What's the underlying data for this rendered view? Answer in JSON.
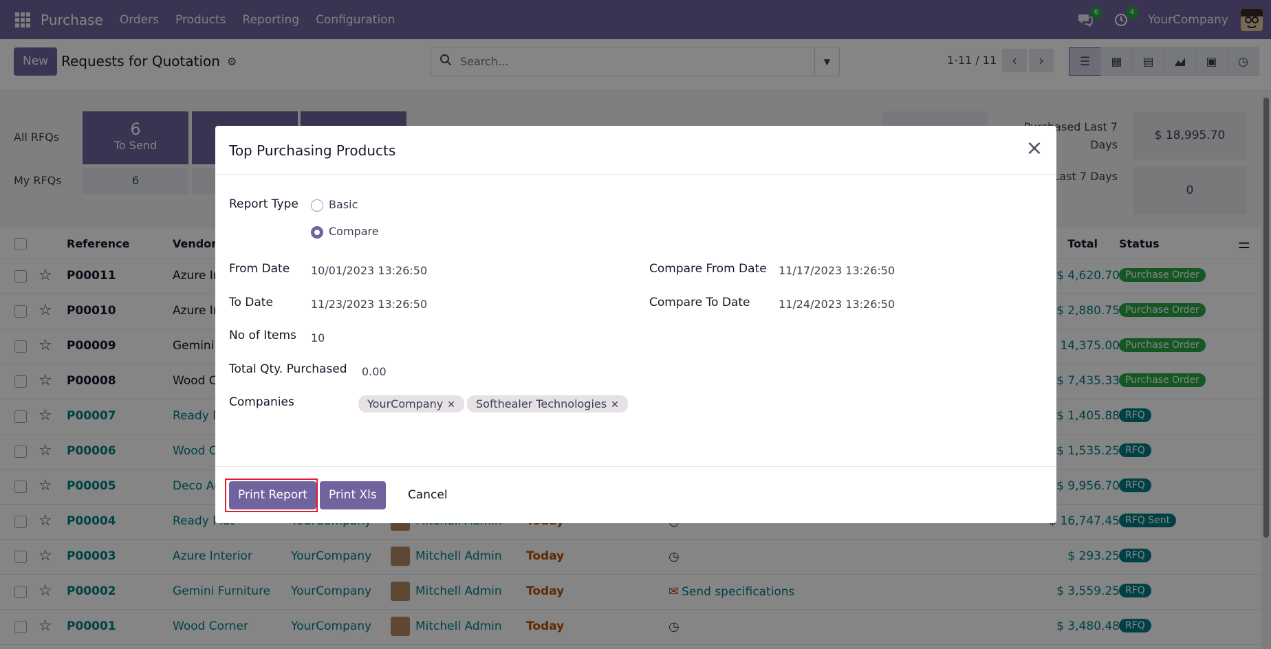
{
  "navbar": {
    "app_name": "Purchase",
    "menu": [
      "Orders",
      "Products",
      "Reporting",
      "Configuration"
    ],
    "messages_count": "6",
    "activities_count": "4",
    "company": "YourCompany"
  },
  "control": {
    "new_label": "New",
    "title": "Requests for Quotation",
    "search_placeholder": "Search...",
    "pager": "1-11 / 11"
  },
  "dashboard": {
    "all_rfqs_label": "All RFQs",
    "my_rfqs_label": "My RFQs",
    "to_send_count": "6",
    "to_send_label": "To Send",
    "my_to_send": "6",
    "purchased_last_7_label": "Purchased Last 7 Days",
    "purchased_last_7_value": "$ 18,995.70",
    "sent_last_7_label": "Sent Last 7 Days",
    "sent_last_7_value": "0"
  },
  "list": {
    "headers": {
      "reference": "Reference",
      "vendor": "Vendor",
      "total": "Total",
      "status": "Status"
    },
    "rows": [
      {
        "ref": "P00011",
        "vendor": "Azure In",
        "company": "",
        "buyer": "",
        "deadline": "",
        "activity": "",
        "total": "$ 4,620.70",
        "status": "Purchase Order",
        "status_color": "#28a745",
        "rfq": false
      },
      {
        "ref": "P00010",
        "vendor": "Azure In",
        "company": "",
        "buyer": "",
        "deadline": "",
        "activity": "",
        "total": "$ 2,880.75",
        "status": "Purchase Order",
        "status_color": "#28a745",
        "rfq": false
      },
      {
        "ref": "P00009",
        "vendor": "Gemini F",
        "company": "",
        "buyer": "",
        "deadline": "",
        "activity": "",
        "total": "14,375.00",
        "status": "Purchase Order",
        "status_color": "#28a745",
        "rfq": false
      },
      {
        "ref": "P00008",
        "vendor": "Wood C",
        "company": "",
        "buyer": "",
        "deadline": "",
        "activity": "",
        "total": "$ 7,435.33",
        "status": "Purchase Order",
        "status_color": "#28a745",
        "rfq": false
      },
      {
        "ref": "P00007",
        "vendor": "Ready M",
        "company": "",
        "buyer": "",
        "deadline": "",
        "activity": "",
        "total": "$ 1,405.88",
        "status": "RFQ",
        "status_color": "#017e84",
        "rfq": true
      },
      {
        "ref": "P00006",
        "vendor": "Wood C",
        "company": "",
        "buyer": "",
        "deadline": "",
        "activity": "",
        "total": "$ 1,535.25",
        "status": "RFQ",
        "status_color": "#017e84",
        "rfq": true
      },
      {
        "ref": "P00005",
        "vendor": "Deco Ac",
        "company": "",
        "buyer": "",
        "deadline": "",
        "activity": "",
        "total": "$ 9,956.70",
        "status": "RFQ",
        "status_color": "#017e84",
        "rfq": true
      },
      {
        "ref": "P00004",
        "vendor": "Ready Mat",
        "company": "YourCompany",
        "buyer": "Mitchell Admin",
        "deadline": "Today",
        "activity": "",
        "total": "$ 16,747.45",
        "status": "RFQ Sent",
        "status_color": "#017e84",
        "rfq": true
      },
      {
        "ref": "P00003",
        "vendor": "Azure Interior",
        "company": "YourCompany",
        "buyer": "Mitchell Admin",
        "deadline": "Today",
        "activity": "",
        "total": "$ 293.25",
        "status": "RFQ",
        "status_color": "#017e84",
        "rfq": true
      },
      {
        "ref": "P00002",
        "vendor": "Gemini Furniture",
        "company": "YourCompany",
        "buyer": "Mitchell Admin",
        "deadline": "Today",
        "activity": "Send specifications",
        "total": "$ 3,559.25",
        "status": "RFQ",
        "status_color": "#017e84",
        "rfq": true
      },
      {
        "ref": "P00001",
        "vendor": "Wood Corner",
        "company": "YourCompany",
        "buyer": "Mitchell Admin",
        "deadline": "Today",
        "activity": "",
        "total": "$ 3,480.48",
        "status": "RFQ",
        "status_color": "#017e84",
        "rfq": true
      }
    ]
  },
  "modal": {
    "title": "Top Purchasing Products",
    "report_type_label": "Report Type",
    "option_basic": "Basic",
    "option_compare": "Compare",
    "selected": "Compare",
    "from_date_label": "From Date",
    "from_date": "10/01/2023 13:26:50",
    "to_date_label": "To Date",
    "to_date": "11/23/2023 13:26:50",
    "compare_from_label": "Compare From Date",
    "compare_from": "11/17/2023 13:26:50",
    "compare_to_label": "Compare To Date",
    "compare_to": "11/24/2023 13:26:50",
    "items_label": "No of Items",
    "items": "10",
    "qty_label": "Total Qty. Purchased",
    "qty": "0.00",
    "companies_label": "Companies",
    "companies": [
      "YourCompany",
      "Softhealer Technologies"
    ],
    "print_report": "Print Report",
    "print_xls": "Print Xls",
    "cancel": "Cancel"
  }
}
